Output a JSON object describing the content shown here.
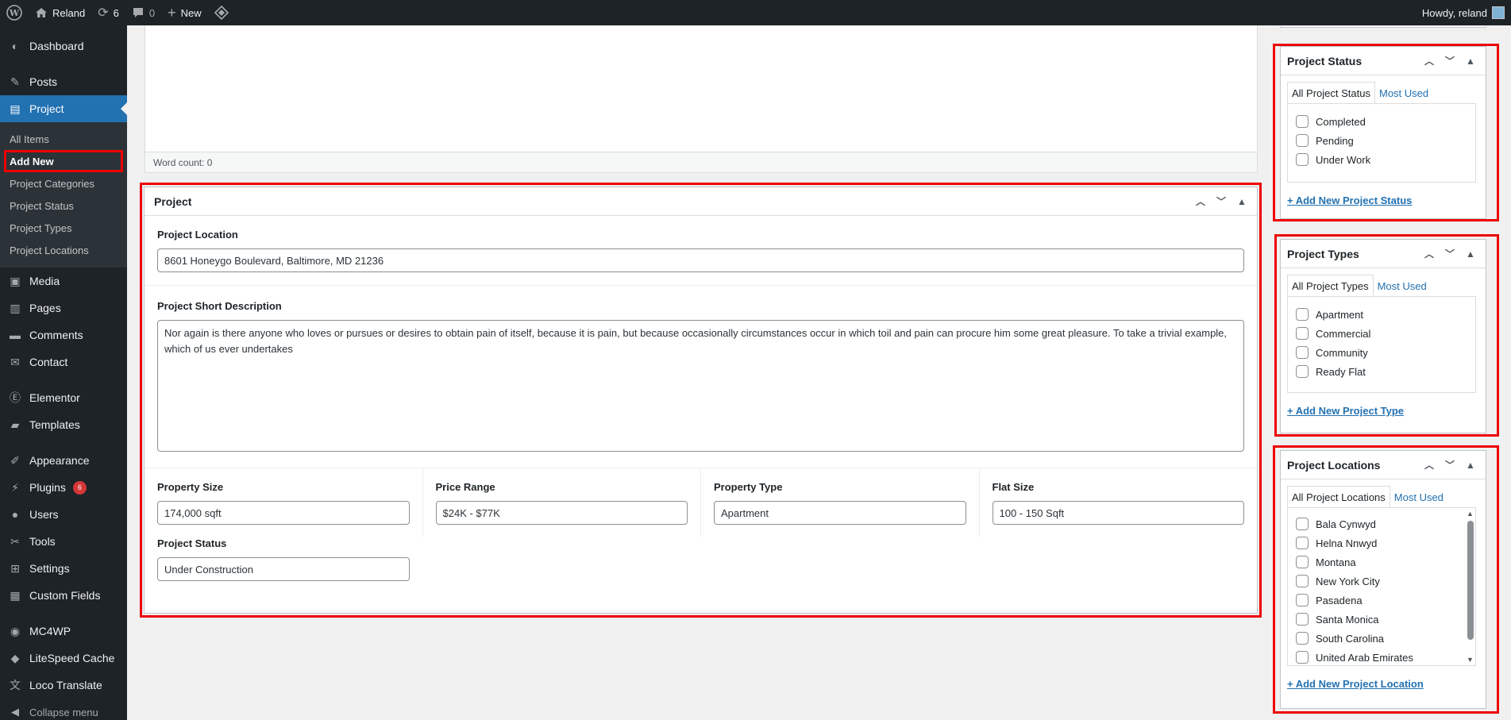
{
  "adminbar": {
    "site_name": "Reland",
    "updates_count": "6",
    "comments_count": "0",
    "new_label": "New",
    "howdy": "Howdy, reland"
  },
  "sidebar": {
    "dashboard": "Dashboard",
    "posts": "Posts",
    "project": "Project",
    "project_sub": [
      "All Items",
      "Add New",
      "Project Categories",
      "Project Status",
      "Project Types",
      "Project Locations"
    ],
    "media": "Media",
    "pages": "Pages",
    "comments": "Comments",
    "contact": "Contact",
    "elementor": "Elementor",
    "templates": "Templates",
    "appearance": "Appearance",
    "plugins": "Plugins",
    "plugins_badge": "6",
    "users": "Users",
    "tools": "Tools",
    "settings": "Settings",
    "custom_fields": "Custom Fields",
    "mc4wp": "MC4WP",
    "litespeed": "LiteSpeed Cache",
    "loco": "Loco Translate",
    "collapse": "Collapse menu"
  },
  "editor": {
    "word_count": "Word count: 0"
  },
  "project_box": {
    "title": "Project",
    "location_label": "Project Location",
    "location_value": "8601 Honeygo Boulevard, Baltimore, MD 21236",
    "short_desc_label": "Project Short Description",
    "short_desc_value": "Nor again is there anyone who loves or pursues or desires to obtain pain of itself, because it is pain, but because occasionally circumstances occur in which toil and pain can procure him some great pleasure. To take a trivial example, which of us ever undertakes",
    "property_size_label": "Property Size",
    "property_size_value": "174,000 sqft",
    "price_range_label": "Price Range",
    "price_range_value": "$24K - $77K",
    "property_type_label": "Property Type",
    "property_type_value": "Apartment",
    "flat_size_label": "Flat Size",
    "flat_size_value": "100 - 150 Sqft",
    "status_label": "Project Status",
    "status_value": "Under Construction"
  },
  "status_box": {
    "title": "Project Status",
    "tab_all": "All Project Status",
    "tab_most": "Most Used",
    "items": [
      "Completed",
      "Pending",
      "Under Work"
    ],
    "add_link": "+ Add New Project Status"
  },
  "types_box": {
    "title": "Project Types",
    "tab_all": "All Project Types",
    "tab_most": "Most Used",
    "items": [
      "Apartment",
      "Commercial",
      "Community",
      "Ready Flat"
    ],
    "add_link": "+ Add New Project Type"
  },
  "locations_box": {
    "title": "Project Locations",
    "tab_all": "All Project Locations",
    "tab_most": "Most Used",
    "items": [
      "Bala Cynwyd",
      "Helna Nnwyd",
      "Montana",
      "New York City",
      "Pasadena",
      "Santa Monica",
      "South Carolina",
      "United Arab Emirates"
    ],
    "add_link": "+ Add New Project Location"
  }
}
